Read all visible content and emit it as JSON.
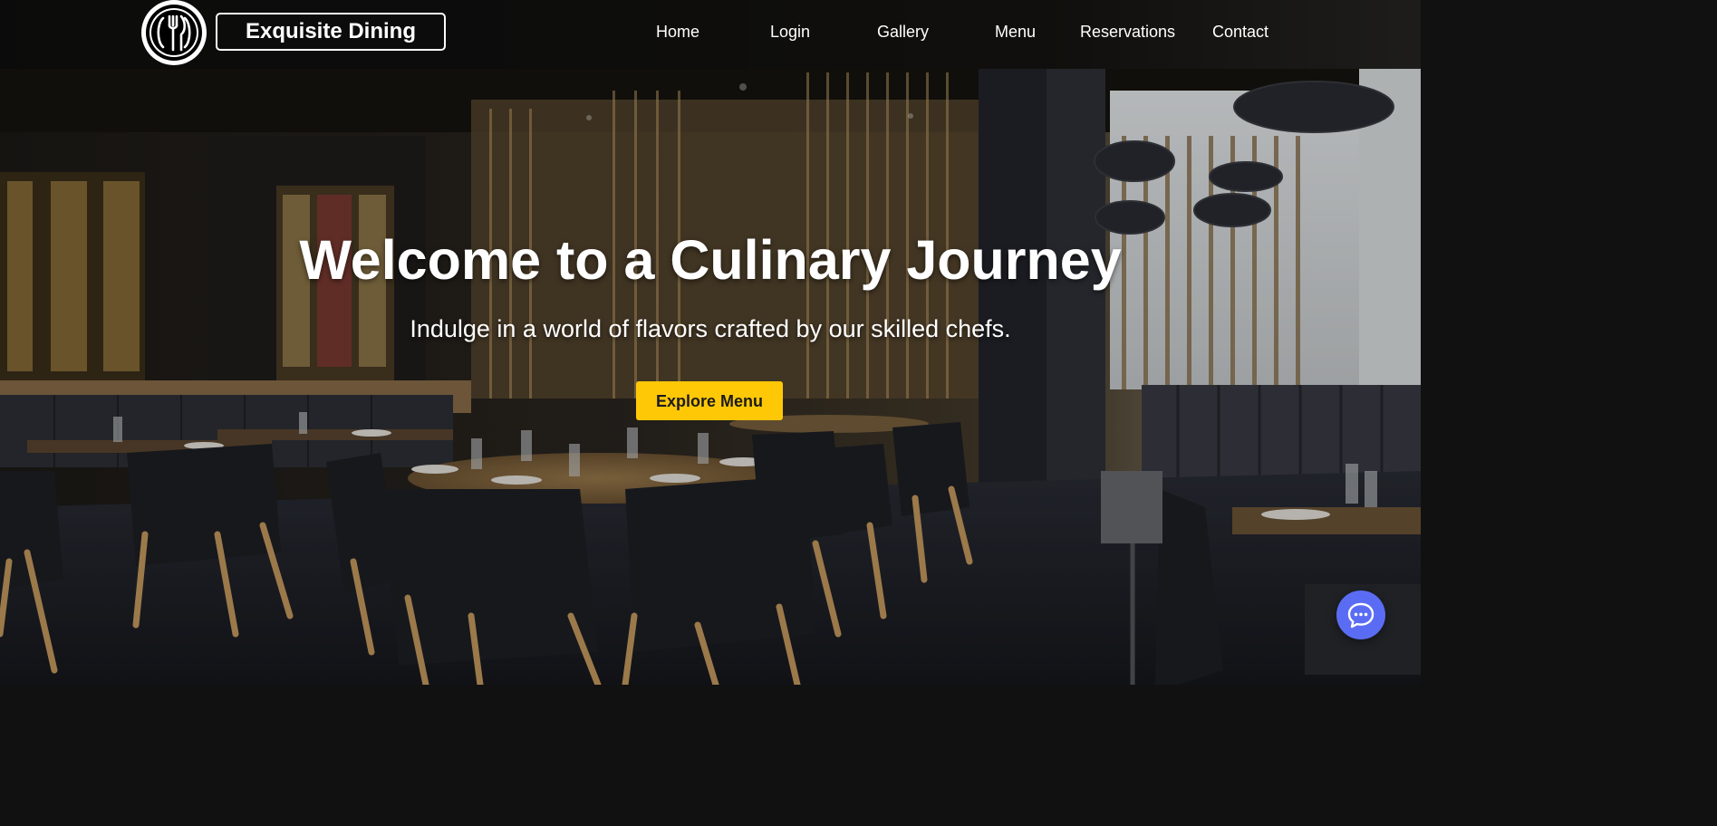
{
  "brand": {
    "name": "Exquisite Dining",
    "logo_icon": "fork-and-knife-icon"
  },
  "nav": {
    "items": [
      {
        "label": "Home"
      },
      {
        "label": "Login"
      },
      {
        "label": "Gallery"
      },
      {
        "label": "Menu"
      },
      {
        "label": "Reservations"
      },
      {
        "label": "Contact"
      }
    ]
  },
  "hero": {
    "title": "Welcome to a Culinary Journey",
    "subtitle": "Indulge in a world of flavors crafted by our skilled chefs.",
    "cta_label": "Explore Menu"
  },
  "chat": {
    "icon": "chat-bubble-icon"
  },
  "colors": {
    "accent": "#ffc807",
    "navbar": "#0a0a0a",
    "chat_button": "#5b6cf4",
    "text": "#ffffff"
  }
}
